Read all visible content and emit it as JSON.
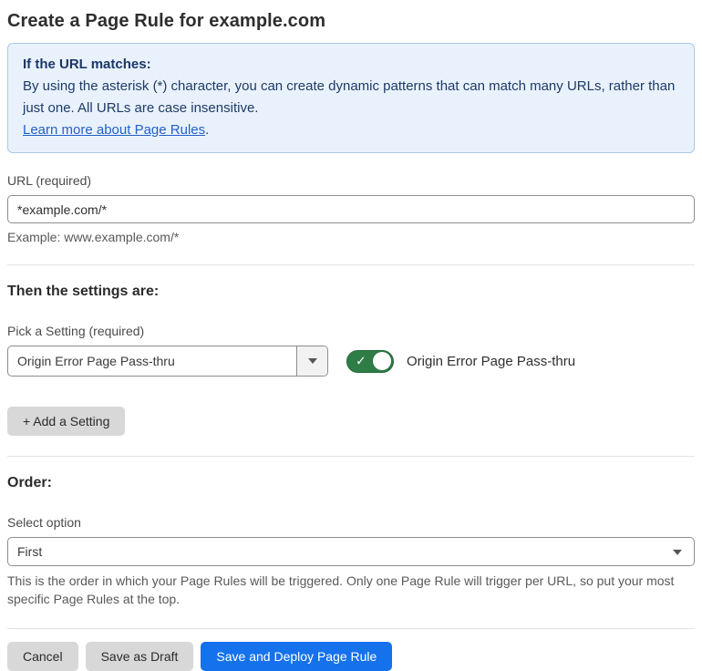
{
  "page": {
    "title": "Create a Page Rule for example.com"
  },
  "info_box": {
    "heading": "If the URL matches:",
    "body": "By using the asterisk (*) character, you can create dynamic patterns that can match many URLs, rather than just one. All URLs are case insensitive.",
    "link_label": "Learn more about Page Rules",
    "link_suffix": "."
  },
  "url_field": {
    "label": "URL (required)",
    "value": "*example.com/*",
    "example": "Example: www.example.com/*"
  },
  "settings": {
    "heading": "Then the settings are:",
    "picker_label": "Pick a Setting (required)",
    "selected_setting": "Origin Error Page Pass-thru",
    "toggle_state": "on",
    "toggle_check_glyph": "✓",
    "toggle_label": "Origin Error Page Pass-thru",
    "add_setting_label": "+ Add a Setting"
  },
  "order": {
    "heading": "Order:",
    "select_label": "Select option",
    "selected_option": "First",
    "help_text": "This is the order in which your Page Rules will be triggered. Only one Page Rule will trigger per URL, so put your most specific Page Rules at the top."
  },
  "footer": {
    "cancel_label": "Cancel",
    "save_draft_label": "Save as Draft",
    "save_deploy_label": "Save and Deploy Page Rule"
  },
  "colors": {
    "info_bg": "#e9f2fc",
    "info_border": "#a9c8e9",
    "info_text": "#1e3a68",
    "link_blue": "#2460c9",
    "toggle_green": "#2f7d46",
    "primary_blue": "#1672ec",
    "button_gray": "#d8d8d8"
  }
}
